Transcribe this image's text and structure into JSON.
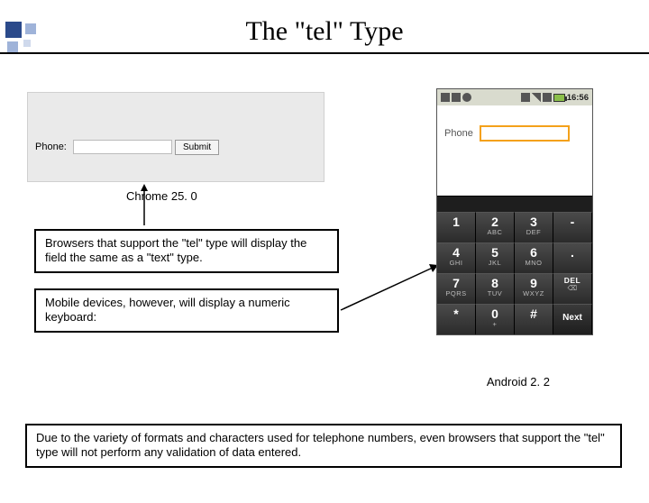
{
  "title": "The \"tel\" Type",
  "chrome": {
    "label": "Phone:",
    "submit": "Submit",
    "caption": "Chrome 25. 0"
  },
  "callouts": {
    "desktop": "Browsers that support the \"tel\" type will display the field the same as a \"text\" type.",
    "mobile": "Mobile devices, however, will display a numeric keyboard:",
    "footer": "Due to the variety of formats and characters used for telephone numbers, even browsers that support the \"tel\" type will not perform any validation of data entered."
  },
  "phone": {
    "time": "16:56",
    "label": "Phone",
    "caption": "Android 2. 2",
    "keys": [
      {
        "big": "1",
        "sub": ""
      },
      {
        "big": "2",
        "sub": "ABC"
      },
      {
        "big": "3",
        "sub": "DEF"
      },
      {
        "big": "-",
        "sub": ""
      },
      {
        "big": "4",
        "sub": "GHI"
      },
      {
        "big": "5",
        "sub": "JKL"
      },
      {
        "big": "6",
        "sub": "MNO"
      },
      {
        "big": ".",
        "sub": ""
      },
      {
        "big": "7",
        "sub": "PQRS"
      },
      {
        "big": "8",
        "sub": "TUV"
      },
      {
        "big": "9",
        "sub": "WXYZ"
      },
      {
        "big": "DEL",
        "sub": "⌫",
        "del": true
      },
      {
        "big": "*",
        "sub": ""
      },
      {
        "big": "0",
        "sub": "+"
      },
      {
        "big": "#",
        "sub": ""
      },
      {
        "big": "Next",
        "sub": "",
        "next": true
      }
    ]
  }
}
